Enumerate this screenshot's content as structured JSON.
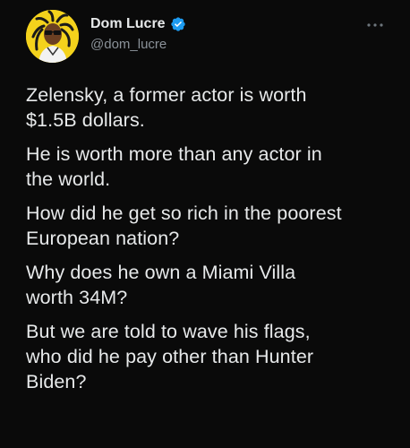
{
  "account": {
    "display_name": "Dom Lucre",
    "handle": "@dom_lucre",
    "verified": true,
    "avatar_icon": "cartoon-avatar-icon",
    "verified_icon": "verified-badge-icon",
    "more_icon": "more-options-icon"
  },
  "colors": {
    "background": "#000000",
    "text": "#e7e9ea",
    "secondary_text": "#8b9299",
    "verified_blue": "#1d9bf0",
    "avatar_bg": "#f4d21c"
  },
  "tweet": {
    "paragraphs": [
      "Zelensky, a former actor is worth\n$1.5B dollars.",
      "He is worth more than any actor in\nthe world.",
      "How did he get so rich in the poorest\nEuropean nation?",
      "Why does he own a Miami Villa\nworth 34M?",
      "But we are told to wave his flags,\nwho did he pay other than Hunter\nBiden?"
    ]
  }
}
